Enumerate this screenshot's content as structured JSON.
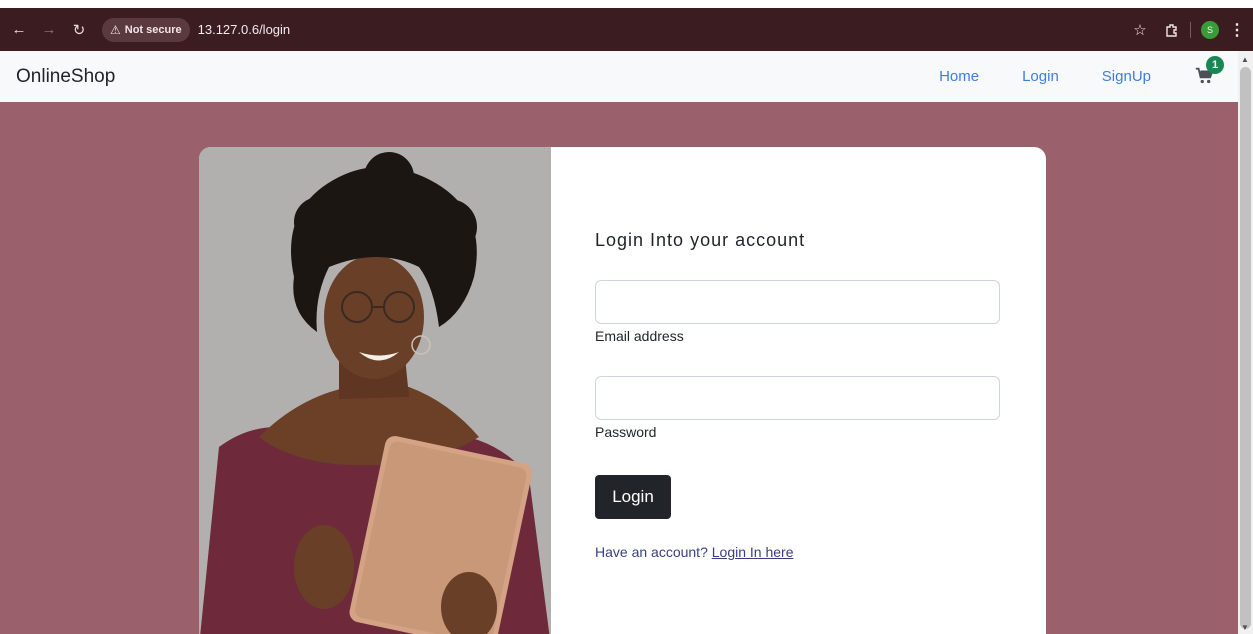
{
  "browser": {
    "security_label": "Not secure",
    "url": "13.127.0.6/login",
    "profile_initial": "S"
  },
  "navbar": {
    "brand": "OnlineShop",
    "links": [
      "Home",
      "Login",
      "SignUp"
    ],
    "cart_count": "1"
  },
  "login": {
    "title": "Login Into your account",
    "email_label": "Email address",
    "password_label": "Password",
    "button_label": "Login",
    "account_prompt": "Have an account?",
    "account_link": "Login In here"
  },
  "colors": {
    "browser_bar": "#3b1c21",
    "page_background": "#9a616d",
    "nav_link": "#3e7de0",
    "button": "#212529",
    "badge": "#198754"
  }
}
